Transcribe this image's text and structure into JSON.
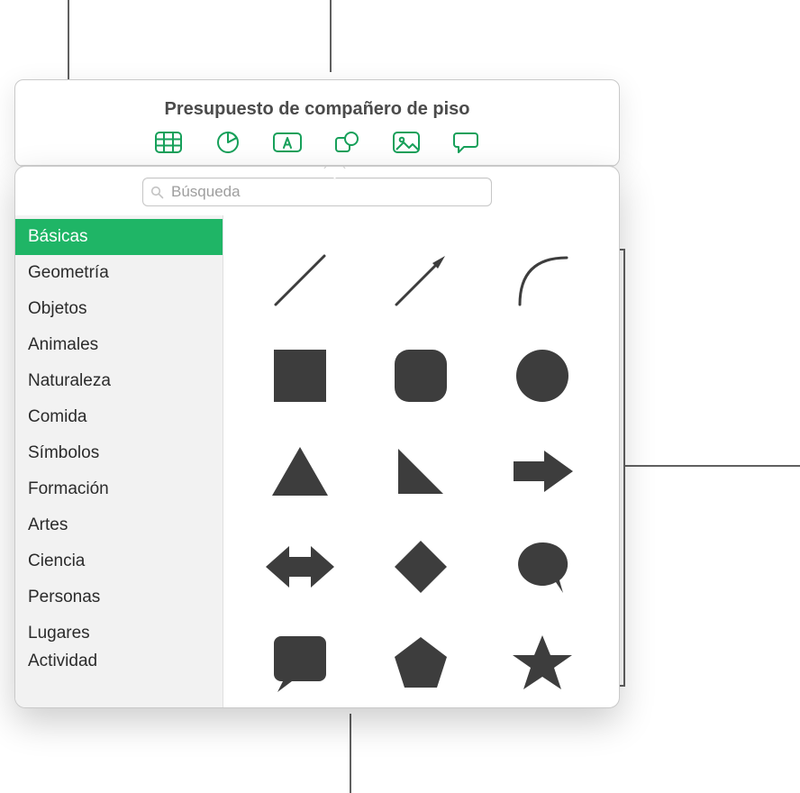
{
  "colors": {
    "accent": "#1fb566",
    "icon": "#17a05a",
    "shape": "#3d3d3d"
  },
  "window": {
    "title": "Presupuesto de compañero de piso"
  },
  "toolbar": {
    "items": [
      {
        "id": "table",
        "name": "table-icon"
      },
      {
        "id": "chart",
        "name": "chart-icon"
      },
      {
        "id": "text",
        "name": "text-box-icon"
      },
      {
        "id": "shape",
        "name": "shape-icon"
      },
      {
        "id": "media",
        "name": "media-icon"
      },
      {
        "id": "comment",
        "name": "comment-icon"
      }
    ]
  },
  "search": {
    "placeholder": "Búsqueda",
    "value": ""
  },
  "sidebar": {
    "items": [
      {
        "label": "Básicas",
        "selected": true
      },
      {
        "label": "Geometría",
        "selected": false
      },
      {
        "label": "Objetos",
        "selected": false
      },
      {
        "label": "Animales",
        "selected": false
      },
      {
        "label": "Naturaleza",
        "selected": false
      },
      {
        "label": "Comida",
        "selected": false
      },
      {
        "label": "Símbolos",
        "selected": false
      },
      {
        "label": "Formación",
        "selected": false
      },
      {
        "label": "Artes",
        "selected": false
      },
      {
        "label": "Ciencia",
        "selected": false
      },
      {
        "label": "Personas",
        "selected": false
      },
      {
        "label": "Lugares",
        "selected": false
      },
      {
        "label": "Actividad",
        "selected": false,
        "clipped": true
      }
    ]
  },
  "shapes": {
    "items": [
      {
        "id": "line",
        "name": "line-shape-icon"
      },
      {
        "id": "arrow-line",
        "name": "arrow-line-shape-icon"
      },
      {
        "id": "curve",
        "name": "curve-shape-icon"
      },
      {
        "id": "square",
        "name": "square-shape-icon"
      },
      {
        "id": "rounded-square",
        "name": "rounded-square-shape-icon"
      },
      {
        "id": "circle",
        "name": "circle-shape-icon"
      },
      {
        "id": "triangle",
        "name": "triangle-shape-icon"
      },
      {
        "id": "right-triangle",
        "name": "right-triangle-shape-icon"
      },
      {
        "id": "arrow-right",
        "name": "arrow-right-shape-icon"
      },
      {
        "id": "arrow-bidir",
        "name": "arrow-bidirectional-shape-icon"
      },
      {
        "id": "diamond",
        "name": "diamond-shape-icon"
      },
      {
        "id": "speech-bubble",
        "name": "speech-bubble-shape-icon"
      },
      {
        "id": "callout-square",
        "name": "square-callout-shape-icon"
      },
      {
        "id": "pentagon",
        "name": "pentagon-shape-icon"
      },
      {
        "id": "star",
        "name": "star-shape-icon"
      }
    ]
  }
}
